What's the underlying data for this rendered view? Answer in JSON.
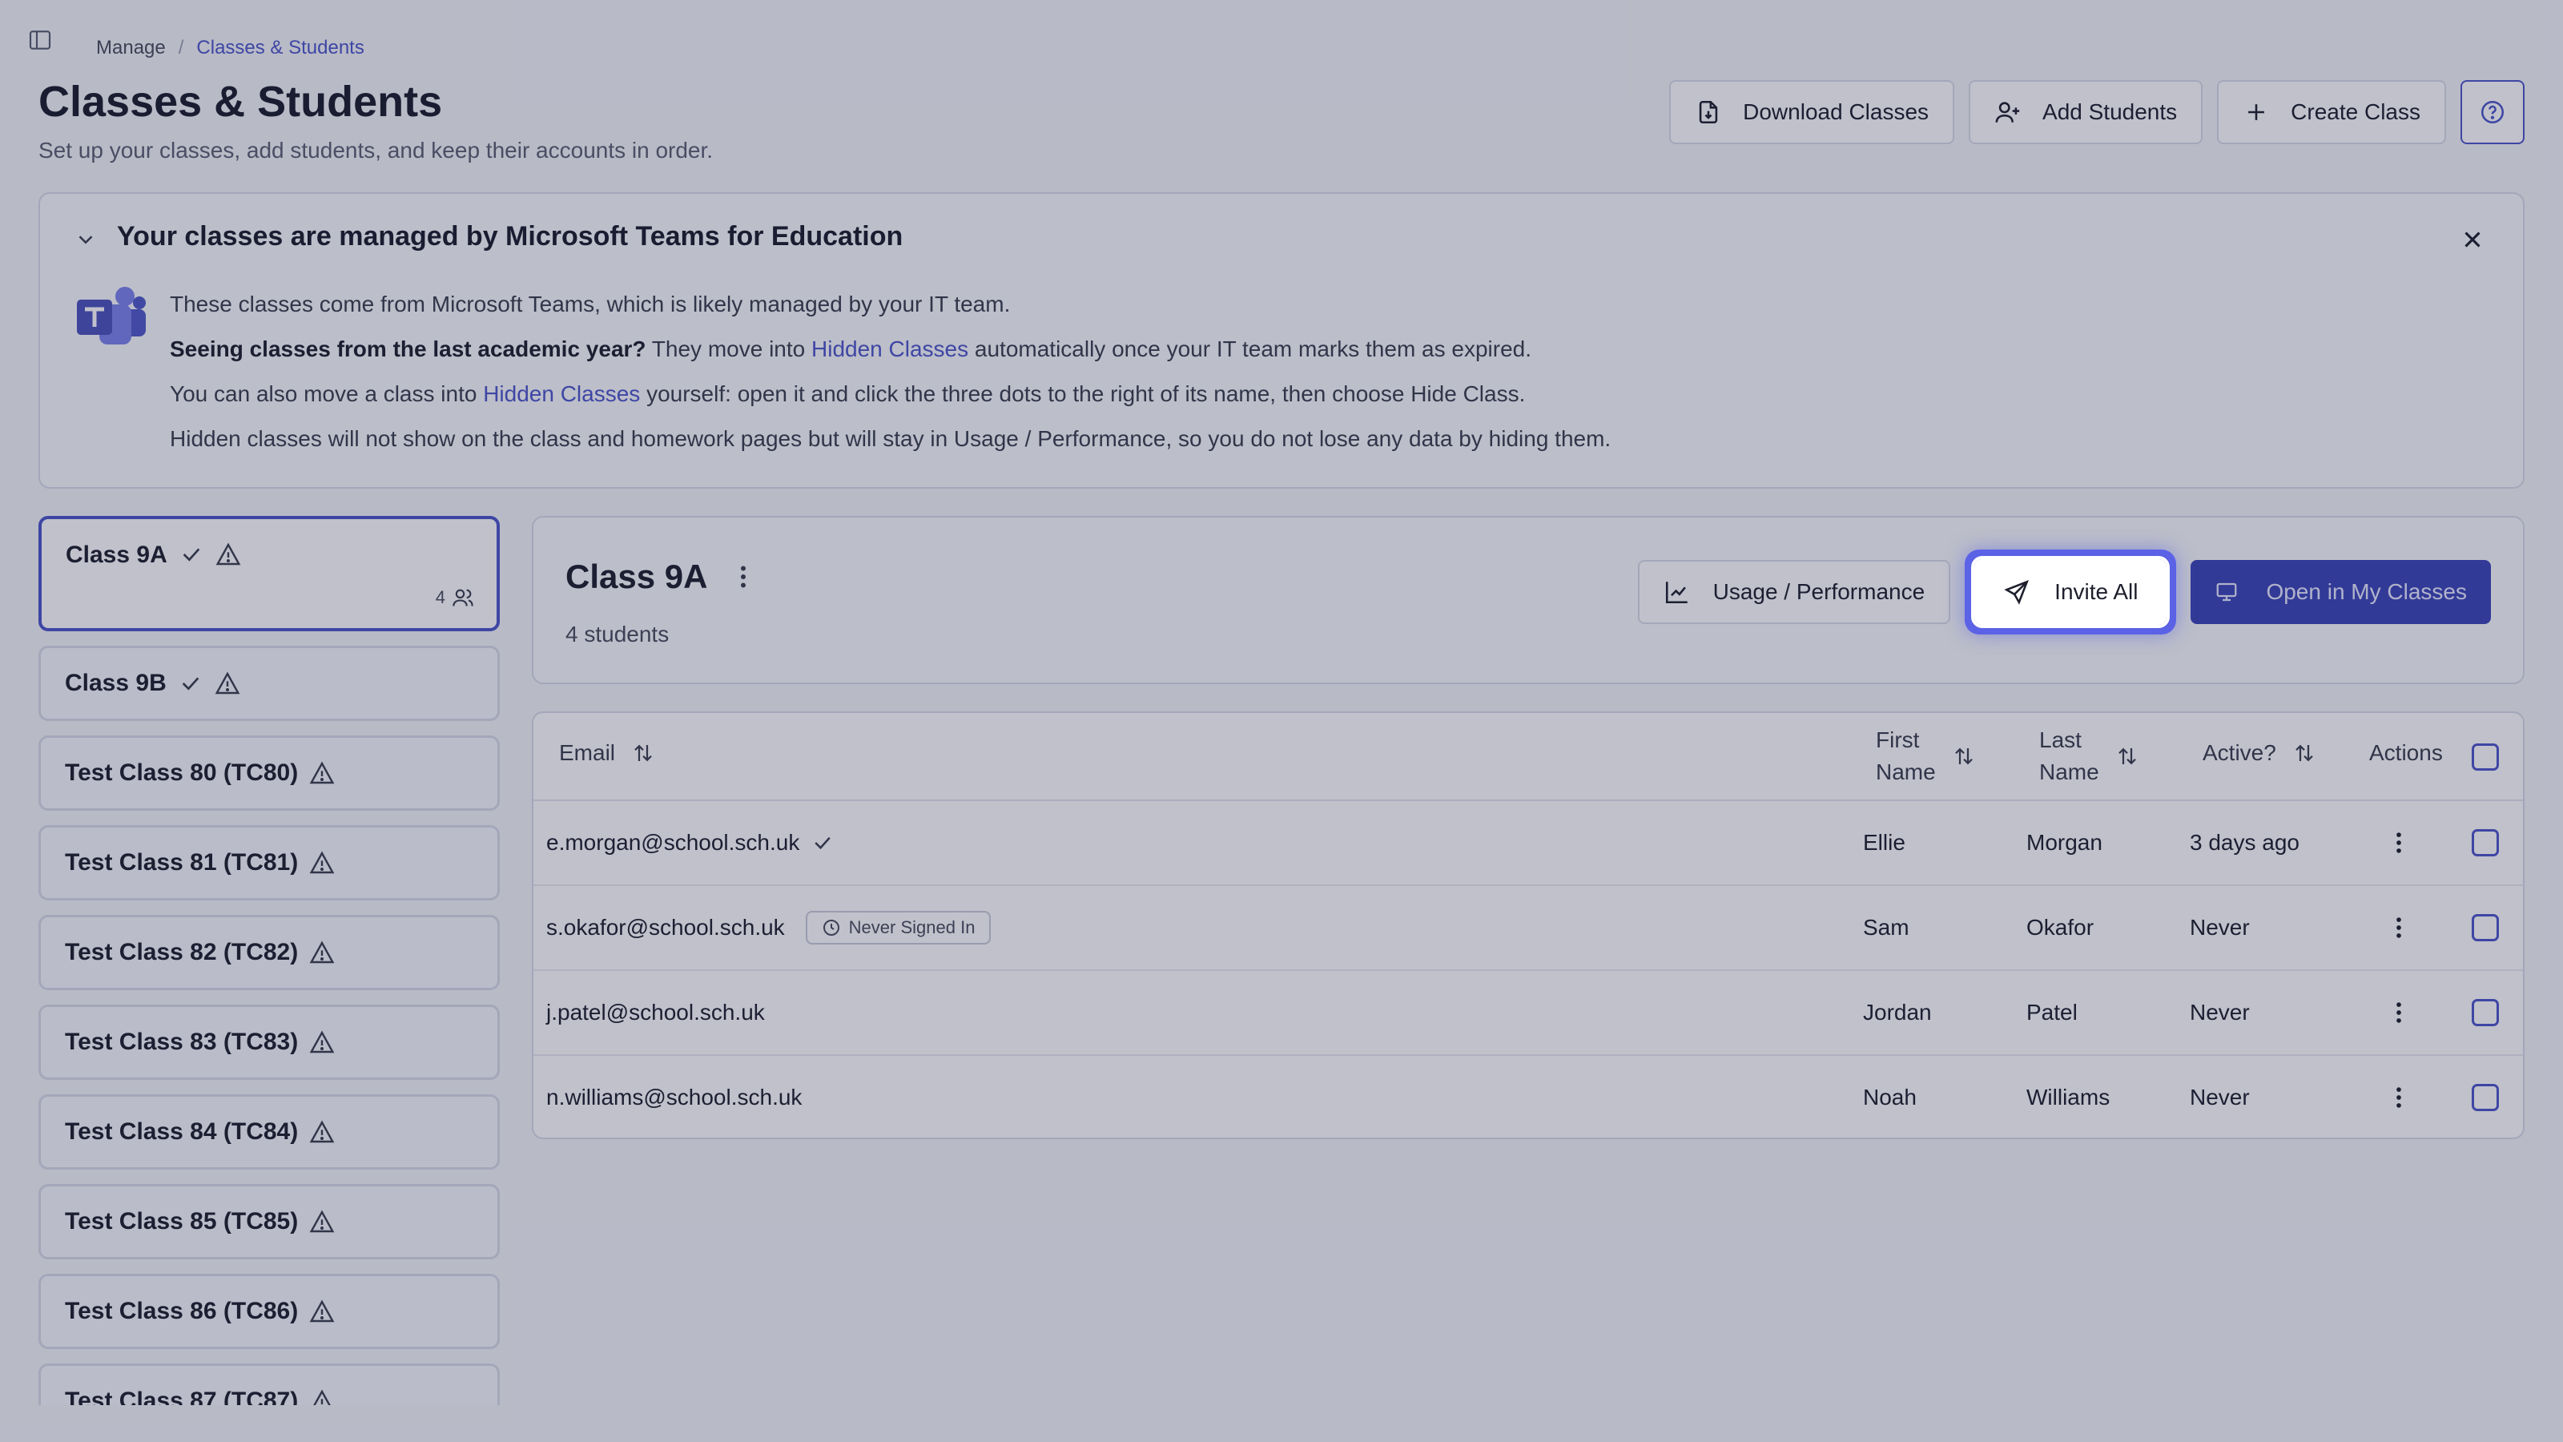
{
  "breadcrumb": {
    "manage": "Manage",
    "separator": "/",
    "current": "Classes & Students"
  },
  "page": {
    "title": "Classes & Students",
    "subtitle": "Set up your classes, add students, and keep their accounts in order."
  },
  "header_actions": {
    "download": "Download Classes",
    "add_students": "Add Students",
    "create_class": "Create Class"
  },
  "banner": {
    "title": "Your classes are managed by Microsoft Teams for Education",
    "line1": "These classes come from Microsoft Teams, which is likely managed by your IT team.",
    "line2_bold": "Seeing classes from the last academic year?",
    "line2_pre": " They move into ",
    "line2_link": "Hidden Classes",
    "line2_post": " automatically once your IT team marks them as expired.",
    "line3_pre": "You can also move a class into ",
    "line3_link": "Hidden Classes",
    "line3_post": " yourself: open it and click the three dots to the right of its name, then choose Hide Class.",
    "line4": "Hidden classes will not show on the class and homework pages but will stay in Usage / Performance, so you do not lose any data by hiding them."
  },
  "classes": [
    {
      "name": "Class 9A",
      "count": "4"
    },
    {
      "name": "Class 9B"
    },
    {
      "name": "Test Class 80 (TC80)"
    },
    {
      "name": "Test Class 81 (TC81)"
    },
    {
      "name": "Test Class 82 (TC82)"
    },
    {
      "name": "Test Class 83 (TC83)"
    },
    {
      "name": "Test Class 84 (TC84)"
    },
    {
      "name": "Test Class 85 (TC85)"
    },
    {
      "name": "Test Class 86 (TC86)"
    },
    {
      "name": "Test Class 87 (TC87)"
    }
  ],
  "selected_class": {
    "title": "Class 9A",
    "subtitle": "4 students",
    "usage": "Usage / Performance",
    "invite": "Invite All",
    "open": "Open in My Classes"
  },
  "table": {
    "headers": {
      "email": "Email",
      "first_line1": "First",
      "first_line2": "Name",
      "last_line1": "Last",
      "last_line2": "Name",
      "active": "Active?",
      "actions": "Actions"
    },
    "rows": [
      {
        "email": "e.morgan@school.sch.uk",
        "first": "Ellie",
        "last": "Morgan",
        "active": "3 days ago"
      },
      {
        "email": "s.okafor@school.sch.uk",
        "badge": "Never Signed In",
        "first": "Sam",
        "last": "Okafor",
        "active": "Never"
      },
      {
        "email": "j.patel@school.sch.uk",
        "first": "Jordan",
        "last": "Patel",
        "active": "Never"
      },
      {
        "email": "n.williams@school.sch.uk",
        "first": "Noah",
        "last": "Williams",
        "active": "Never"
      }
    ]
  },
  "colors": {
    "accent": "#4b55c9",
    "primary_button": "#3b44b8",
    "highlight": "#5b62e6"
  }
}
